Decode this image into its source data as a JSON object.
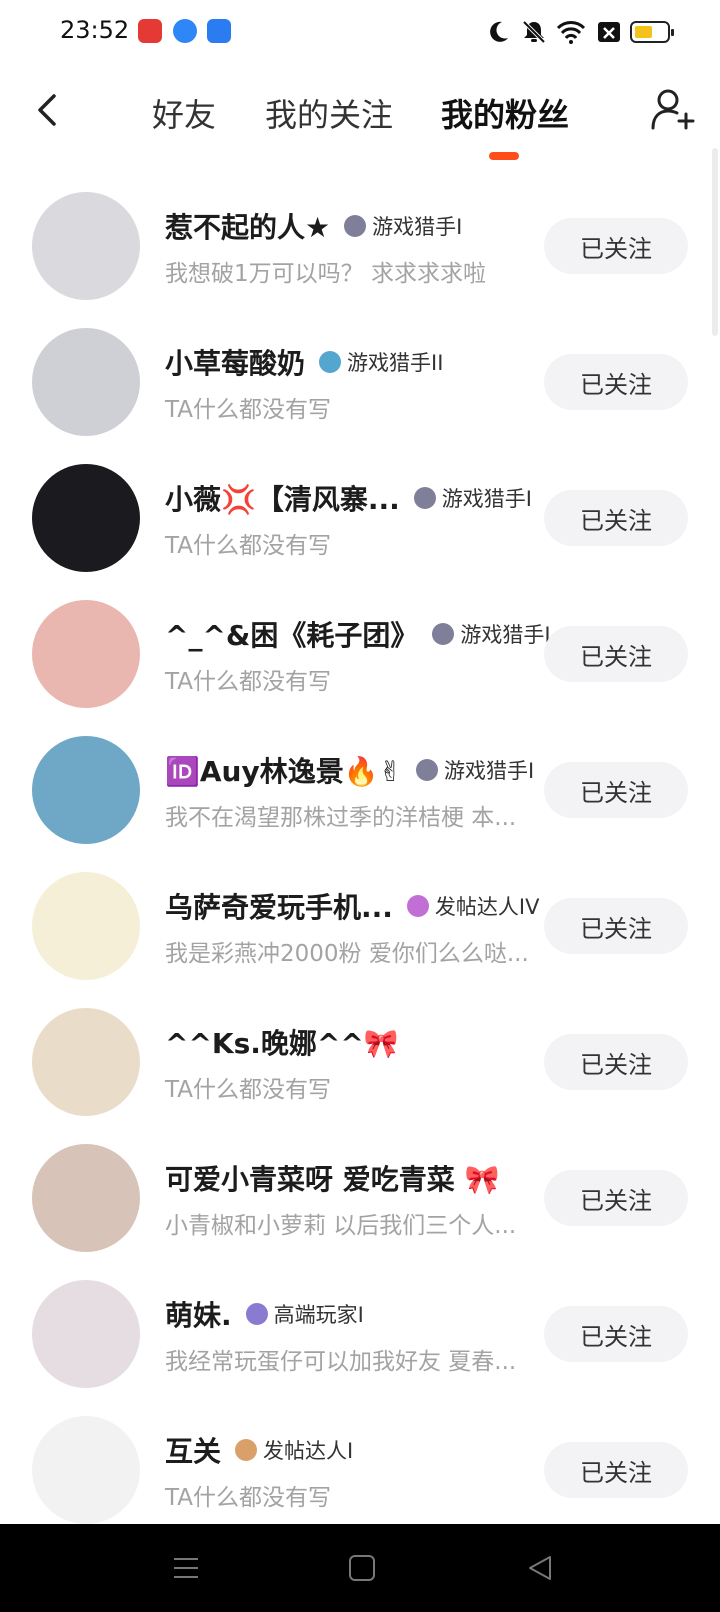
{
  "status_bar": {
    "time": "23:52",
    "icons": [
      "video-app-icon",
      "blue-app-icon",
      "photo-app-icon",
      "moon-icon",
      "mute-icon",
      "wifi-icon",
      "close-box-icon",
      "battery-icon"
    ],
    "battery_level": 0.55
  },
  "header": {
    "tabs": [
      "好友",
      "我的关注",
      "我的粉丝"
    ],
    "active_tab": "我的粉丝",
    "accent_color": "#ff4d19"
  },
  "list": [
    {
      "name": "惹不起的人★",
      "badge": "游戏猎手I",
      "desc": "我想破1万可以吗？ 求求求求啦",
      "button": "已关注",
      "avatar_color": "#d9d9de",
      "badge_color": "#7f7f9a"
    },
    {
      "name": "小草莓酸奶",
      "badge": "游戏猎手II",
      "desc": "TA什么都没有写",
      "button": "已关注",
      "avatar_color": "#cfcfd6",
      "badge_color": "#55a6cf"
    },
    {
      "name": "小薇💢【清风寨...",
      "badge": "游戏猎手I",
      "desc": "TA什么都没有写",
      "button": "已关注",
      "avatar_color": "#1b1b1f",
      "badge_color": "#7f7f9a"
    },
    {
      "name": "^_^&困《耗子团》",
      "badge": "游戏猎手I",
      "desc": "TA什么都没有写",
      "button": "已关注",
      "avatar_color": "#e9b7b0",
      "badge_color": "#7f7f9a"
    },
    {
      "name": "🆔Auy林逸景🔥✌",
      "badge": "游戏猎手I",
      "desc": "我不在渴望那株过季的洋桔梗 本...",
      "button": "已关注",
      "avatar_color": "#6fa7c6",
      "badge_color": "#7f7f9a"
    },
    {
      "name": "乌萨奇爱玩手机...",
      "badge": "发帖达人IV",
      "desc": "我是彩燕冲2000粉 爱你们么么哒...",
      "button": "已关注",
      "avatar_color": "#f4efd6",
      "badge_color": "#c16fd4"
    },
    {
      "name": "^^Ks.晚娜^^🎀",
      "badge": "",
      "desc": "TA什么都没有写",
      "button": "已关注",
      "avatar_color": "#e9ddc9",
      "badge_color": "#ffffff"
    },
    {
      "name": "可爱小青菜呀 爱吃青菜 🎀",
      "badge": "",
      "desc": "小青椒和小萝莉 以后我们三个人...",
      "button": "已关注",
      "avatar_color": "#d7c3b8",
      "badge_color": "#ffffff"
    },
    {
      "name": "萌妹.",
      "badge": "高端玩家I",
      "desc": "我经常玩蛋仔可以加我好友 夏春...",
      "button": "已关注",
      "avatar_color": "#e6dde2",
      "badge_color": "#8a7bd0"
    },
    {
      "name": "互关",
      "badge": "发帖达人I",
      "desc": "TA什么都没有写",
      "button": "已关注",
      "avatar_color": "#f2f2f2",
      "badge_color": "#d9a06a"
    }
  ],
  "nav_bar": {
    "buttons": [
      "menu-icon",
      "home-icon",
      "back-triangle-icon"
    ]
  }
}
